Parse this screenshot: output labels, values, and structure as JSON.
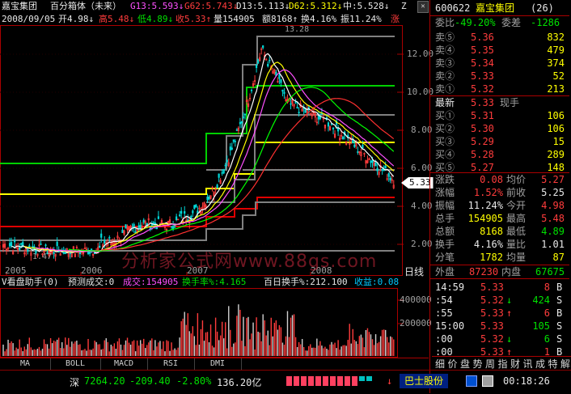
{
  "header": {
    "stock_name": "嘉宝集团",
    "indicator": "百分箱体（未来）",
    "g13": "G13:5.593↓",
    "g62": "G62:5.743↓",
    "d13": "D13:5.113↓",
    "d62": "D62:5.312↓",
    "mid": "中:5.528↓",
    "z": "Z",
    "close_button": "✕"
  },
  "info_line": {
    "date": "2008/09/05",
    "open": "开4.98↓",
    "high": "高5.48↓",
    "low": "低4.89↓",
    "close": "收5.33↑",
    "volume": "量154905",
    "amount": "额8168↑",
    "turnover": "换4.16%",
    "amplitude": "振11.24%",
    "change": "涨"
  },
  "price_axis": [
    "12.00",
    "10.00",
    "8.00",
    "6.00",
    "4.00",
    "2.00"
  ],
  "peak_label": "13.28",
  "low_label": "1.47",
  "current_price_tag": "5.33",
  "year_labels": [
    "2005",
    "2006",
    "2007",
    "2008"
  ],
  "daily_tab": "日线",
  "watermark": "分析家公式网www.88gs.com",
  "volume_panel": {
    "title": "V看盘助手(0)",
    "predict": "预测成交:0",
    "volume": "成交:154905",
    "turnover": "换手率%:4.165",
    "hundred_day": "百日换手%:212.100",
    "yield": "收益:0.08",
    "axis": [
      "400000",
      "200000"
    ]
  },
  "tabs": [
    "MA",
    "BOLL",
    "MACD",
    "RSI",
    "DMI"
  ],
  "status_bar": {
    "index_name": "深",
    "index_value": "7264.20",
    "index_change": "-209.40",
    "index_pct": "-2.80%",
    "index_amount": "136.20亿",
    "stock_ticker": "巴士股份",
    "ticker_arrow": "↓",
    "time": "00:18:26"
  },
  "panel": {
    "code": "600622",
    "name": "嘉宝集团",
    "count": "(26)",
    "weibi_label": "委比",
    "weibi_value": "-49.20%",
    "weicha_label": "委差",
    "weicha_value": "-1286",
    "sells": [
      {
        "label": "卖⑤",
        "price": "5.36",
        "vol": "832"
      },
      {
        "label": "卖④",
        "price": "5.35",
        "vol": "479"
      },
      {
        "label": "卖③",
        "price": "5.34",
        "vol": "374"
      },
      {
        "label": "卖②",
        "price": "5.33",
        "vol": "52"
      },
      {
        "label": "卖①",
        "price": "5.32",
        "vol": "213"
      }
    ],
    "latest_label": "最新",
    "latest_price": "5.33",
    "cash_label": "现手",
    "buys": [
      {
        "label": "买①",
        "price": "5.31",
        "vol": "106"
      },
      {
        "label": "买②",
        "price": "5.30",
        "vol": "106"
      },
      {
        "label": "买③",
        "price": "5.29",
        "vol": "15"
      },
      {
        "label": "买④",
        "price": "5.28",
        "vol": "289"
      },
      {
        "label": "买⑤",
        "price": "5.27",
        "vol": "148"
      }
    ],
    "stats": [
      {
        "l1": "涨跌",
        "v1": "0.08",
        "l2": "均价",
        "v2": "5.27"
      },
      {
        "l1": "涨幅",
        "v1": "1.52%",
        "l2": "前收",
        "v2": "5.25"
      },
      {
        "l1": "振幅",
        "v1": "11.24%",
        "l2": "今开",
        "v2": "4.98"
      },
      {
        "l1": "总手",
        "v1": "154905",
        "l2": "最高",
        "v2": "5.48"
      },
      {
        "l1": "总额",
        "v1": "8168",
        "l2": "最低",
        "v2": "4.89"
      },
      {
        "l1": "换手",
        "v1": "4.16%",
        "l2": "量比",
        "v2": "1.01"
      },
      {
        "l1": "分笔",
        "v1": "1782",
        "l2": "均量",
        "v2": "87"
      }
    ],
    "outer_label": "外盘",
    "outer_value": "87230",
    "inner_label": "内盘",
    "inner_value": "67675",
    "ticks": [
      {
        "time": "14:59",
        "price": "5.33",
        "arrow": "",
        "vol": "8",
        "side": "B"
      },
      {
        "time": ":54",
        "price": "5.32",
        "arrow": "↓",
        "vol": "424",
        "side": "S"
      },
      {
        "time": ":55",
        "price": "5.33",
        "arrow": "↑",
        "vol": "6",
        "side": "B"
      },
      {
        "time": "15:00",
        "price": "5.33",
        "arrow": "",
        "vol": "105",
        "side": "S"
      },
      {
        "time": ":00",
        "price": "5.32",
        "arrow": "↓",
        "vol": "6",
        "side": "S"
      },
      {
        "time": ":00",
        "price": "5.33",
        "arrow": "↑",
        "vol": "1",
        "side": "B"
      }
    ],
    "bottom_tabs": [
      "细",
      "价",
      "盘",
      "势",
      "周",
      "指",
      "财",
      "讯",
      "成",
      "特",
      "解"
    ]
  }
}
